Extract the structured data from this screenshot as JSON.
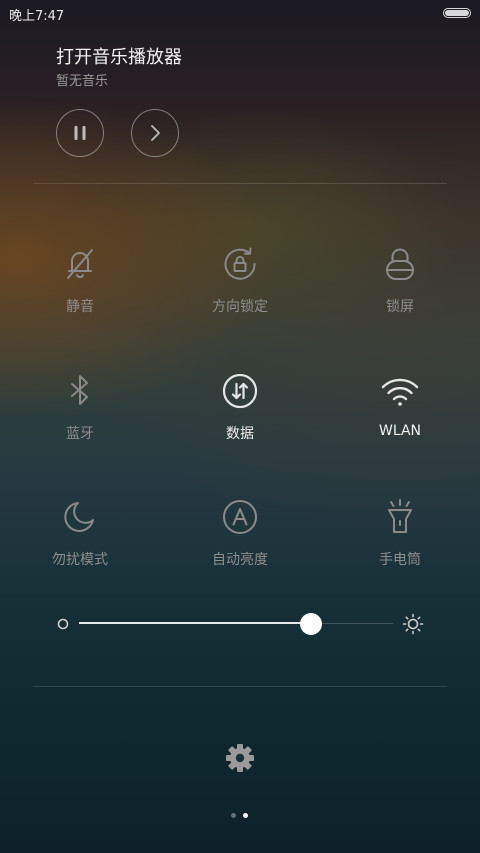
{
  "status_bar": {
    "time": "晚上7:47",
    "battery_icon": "battery-icon"
  },
  "music": {
    "title": "打开音乐播放器",
    "subtitle": "暂无音乐",
    "pause_icon": "pause-icon",
    "next_icon": "next-icon"
  },
  "toggles": [
    {
      "label": "静音",
      "icon": "bell-off-icon",
      "active": false
    },
    {
      "label": "方向锁定",
      "icon": "rotation-lock-icon",
      "active": false
    },
    {
      "label": "锁屏",
      "icon": "lock-icon",
      "active": false
    },
    {
      "label": "蓝牙",
      "icon": "bluetooth-icon",
      "active": false
    },
    {
      "label": "数据",
      "icon": "mobile-data-icon",
      "active": true
    },
    {
      "label": "WLAN",
      "icon": "wifi-icon",
      "active": true
    },
    {
      "label": "勿扰模式",
      "icon": "moon-icon",
      "active": false
    },
    {
      "label": "自动亮度",
      "icon": "auto-brightness-icon",
      "active": false
    },
    {
      "label": "手电筒",
      "icon": "flashlight-icon",
      "active": false
    }
  ],
  "brightness": {
    "level": 0.74,
    "min_icon": "brightness-low-icon",
    "max_icon": "brightness-high-icon"
  },
  "settings_icon": "gear-icon",
  "page_indicator": {
    "count": 2,
    "current": 2
  },
  "colors": {
    "active_label": "#f0f0f0",
    "inactive_label": "#8e8e8e",
    "active_icon": "#e6e6e6",
    "inactive_icon": "#8a8a8a"
  }
}
